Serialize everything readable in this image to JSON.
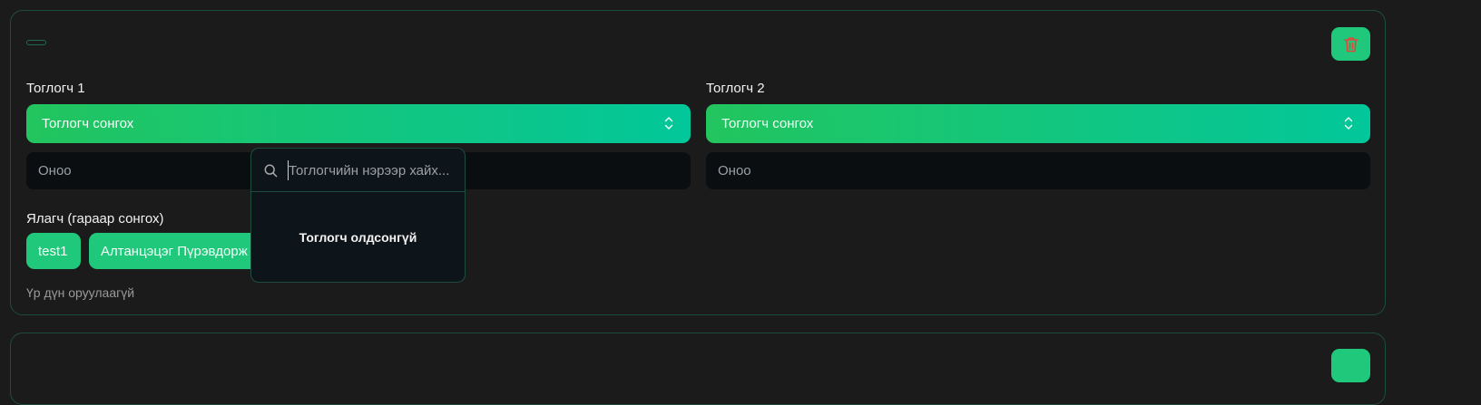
{
  "match": {
    "player1": {
      "label": "Тоглогч 1",
      "select_value": "Тоглогч сонгох",
      "score_placeholder": "Оноо"
    },
    "player2": {
      "label": "Тоглогч 2",
      "select_value": "Тоглогч сонгох",
      "score_placeholder": "Оноо"
    },
    "winner": {
      "label": "Ялагч (гараар сонгох)",
      "options": [
        "test1",
        "Алтанцэцэг Пүрэвдорж"
      ]
    },
    "result_status": "Үр дүн оруулаагүй"
  },
  "dropdown": {
    "search_placeholder": "Тоглогчийн нэрээр хайх...",
    "empty_message": "Тоглогч олдсонгүй"
  },
  "icons": {
    "delete": "trash-icon",
    "select_chevron": "chevron-up-down-icon",
    "search": "search-icon"
  },
  "colors": {
    "accent": "#1fc87a",
    "gradient_start": "#22c55e",
    "gradient_end": "#02c79a",
    "delete_icon": "#e0473a",
    "card_border": "#1e4d3b",
    "background": "#1b1b1b",
    "input_bg": "#0b0e11"
  }
}
